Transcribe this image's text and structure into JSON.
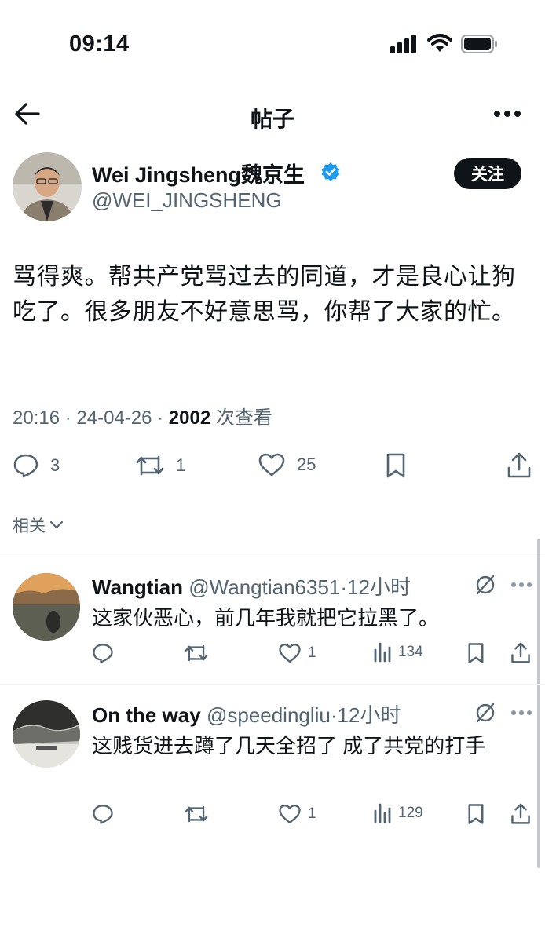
{
  "status_bar": {
    "time": "09:14"
  },
  "nav": {
    "title": "帖子"
  },
  "post": {
    "author_name": "Wei Jingsheng魏京生",
    "handle": "@WEI_JINGSHENG",
    "follow_label": "关注",
    "text": "骂得爽。帮共产党骂过去的同道，才是良心让狗吃了。很多朋友不好意思骂，你帮了大家的忙。",
    "time": "20:16",
    "date": "24-04-26",
    "views": "2002",
    "views_label": "次查看",
    "replies": "3",
    "reposts": "1",
    "likes": "25"
  },
  "related": {
    "label": "相关"
  },
  "replies": [
    {
      "name": "Wangtian",
      "handle": "@Wangtian6351",
      "time": "·12小时",
      "text": "这家伙恶心，前几年我就把它拉黑了。",
      "replies": "",
      "reposts": "",
      "likes": "1",
      "views": "134"
    },
    {
      "name": "On the way",
      "handle": "@speedingliu",
      "time": "·12小时",
      "text": "这贱货进去蹲了几天全招了 成了共党的打手",
      "replies": "",
      "reposts": "",
      "likes": "1",
      "views": "129"
    }
  ],
  "colors": {
    "text": "#0f1419",
    "secondary": "#536471",
    "verified": "#1d9bf0",
    "divider": "#eff3f4"
  }
}
